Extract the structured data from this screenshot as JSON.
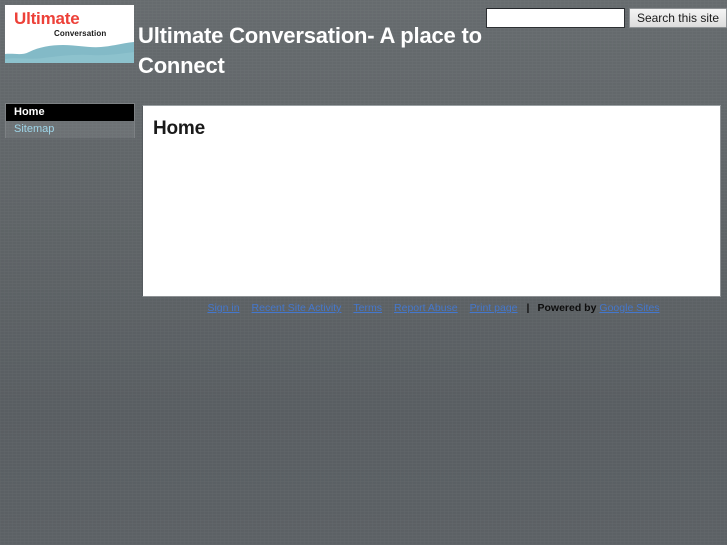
{
  "site": {
    "title": "Ultimate Conversation- A place to Connect",
    "logo": {
      "primary_text": "Ultimate",
      "secondary_text": "Conversation",
      "primary_color": "#ed4139",
      "secondary_color": "#1a1a1a",
      "wave_color": "#7cb6c4",
      "background_color": "#ffffff"
    },
    "background_color": "#5f6468"
  },
  "search": {
    "value": "",
    "placeholder": "",
    "button_label": "Search this site"
  },
  "sidebar": {
    "items": [
      {
        "label": "Home",
        "current": true
      },
      {
        "label": "Sitemap",
        "current": false
      }
    ]
  },
  "main": {
    "page_title": "Home",
    "body_text": ""
  },
  "footer": {
    "links": [
      {
        "label": "Sign in"
      },
      {
        "label": "Recent Site Activity"
      },
      {
        "label": "Terms"
      },
      {
        "label": "Report Abuse"
      },
      {
        "label": "Print page"
      }
    ],
    "separator": "|",
    "powered_by_label": "Powered by",
    "powered_by_link": "Google Sites",
    "link_color": "#4477cc"
  }
}
